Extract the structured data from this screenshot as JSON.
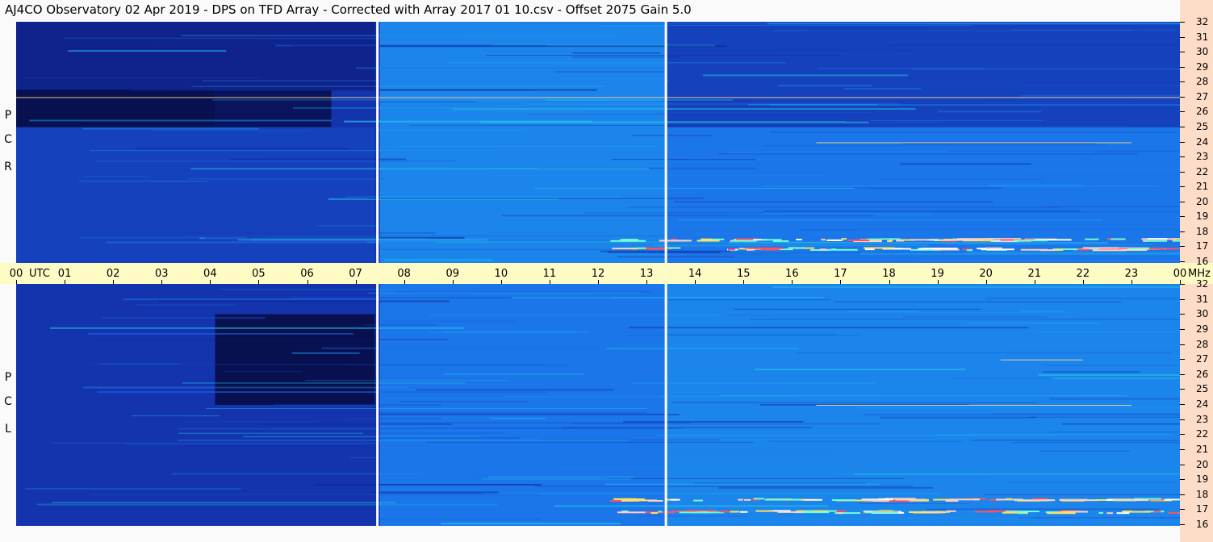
{
  "title": "AJ4CO Observatory  02 Apr 2019  -  DPS on TFD Array  -  Corrected with Array 2017 01 10.csv  -  Offset 2075  Gain 5.0",
  "time_axis": {
    "labels": [
      "00",
      "01",
      "02",
      "03",
      "04",
      "05",
      "06",
      "07",
      "08",
      "09",
      "10",
      "11",
      "12",
      "13",
      "14",
      "15",
      "16",
      "17",
      "18",
      "19",
      "20",
      "21",
      "22",
      "23",
      "00"
    ],
    "utc_label": "UTC",
    "unit_label": "MHz"
  },
  "freq_axis": {
    "labels": [
      "32",
      "31",
      "30",
      "29",
      "28",
      "27",
      "26",
      "25",
      "24",
      "23",
      "22",
      "21",
      "20",
      "19",
      "18",
      "17",
      "16"
    ]
  },
  "panels": [
    {
      "name": "rcp",
      "letters": [
        "R",
        "C",
        "P"
      ]
    },
    {
      "name": "lcp",
      "letters": [
        "L",
        "C",
        "P"
      ]
    }
  ],
  "colors": {
    "background": "#fafafa",
    "time_band": "#fffbc4",
    "right_strip": "#fddcc8",
    "spectrogram_low": "#060a3c",
    "spectrogram_mid": "#1a66e8",
    "spectrogram_high": "#28e8d8",
    "gap_line": "#ffffff"
  },
  "chart_data": [
    {
      "type": "heatmap",
      "title": "R C P",
      "x_unit": "UTC hour",
      "xlim": [
        0,
        24
      ],
      "y_unit": "MHz",
      "ylim": [
        16,
        32
      ],
      "data_gaps_utc": [
        7.45,
        13.4
      ],
      "zones": [
        {
          "x": [
            0,
            4.1
          ],
          "y": [
            25,
            27.5
          ],
          "level": 0.05
        },
        {
          "x": [
            4.1,
            6.5
          ],
          "y": [
            25,
            27.5
          ],
          "level": 0.08
        },
        {
          "x": [
            0,
            7.4
          ],
          "y": [
            27.5,
            32
          ],
          "level": 0.2
        },
        {
          "x": [
            0,
            7.4
          ],
          "y": [
            16,
            25
          ],
          "level": 0.35
        },
        {
          "x": [
            7.5,
            13.4
          ],
          "y": [
            16,
            32
          ],
          "level": 0.6
        },
        {
          "x": [
            13.4,
            24
          ],
          "y": [
            25,
            32
          ],
          "level": 0.35
        },
        {
          "x": [
            13.4,
            24
          ],
          "y": [
            16,
            25
          ],
          "level": 0.55
        }
      ],
      "features": [
        {
          "freq": 27.0,
          "x": [
            0,
            24
          ],
          "kind": "line"
        },
        {
          "freq": 24.0,
          "x": [
            16.5,
            23
          ],
          "kind": "line"
        },
        {
          "freq": 17.6,
          "x": [
            12,
            24
          ],
          "kind": "burst"
        },
        {
          "freq": 17.0,
          "x": [
            12,
            24
          ],
          "kind": "burst"
        }
      ]
    },
    {
      "type": "heatmap",
      "title": "L C P",
      "x_unit": "UTC hour",
      "xlim": [
        0,
        24
      ],
      "y_unit": "MHz",
      "ylim": [
        16,
        32
      ],
      "data_gaps_utc": [
        7.45,
        13.4
      ],
      "zones": [
        {
          "x": [
            4.1,
            7.4
          ],
          "y": [
            24,
            30
          ],
          "level": 0.05
        },
        {
          "x": [
            0,
            4.1
          ],
          "y": [
            16,
            32
          ],
          "level": 0.3
        },
        {
          "x": [
            7.5,
            13.4
          ],
          "y": [
            16,
            32
          ],
          "level": 0.55
        },
        {
          "x": [
            13.4,
            24
          ],
          "y": [
            16,
            32
          ],
          "level": 0.6
        }
      ],
      "features": [
        {
          "freq": 27.0,
          "x": [
            20.3,
            22
          ],
          "kind": "line"
        },
        {
          "freq": 24.0,
          "x": [
            16.5,
            23
          ],
          "kind": "line"
        },
        {
          "freq": 17.8,
          "x": [
            12,
            24
          ],
          "kind": "burst"
        },
        {
          "freq": 17.0,
          "x": [
            12,
            24
          ],
          "kind": "burst"
        }
      ]
    }
  ]
}
